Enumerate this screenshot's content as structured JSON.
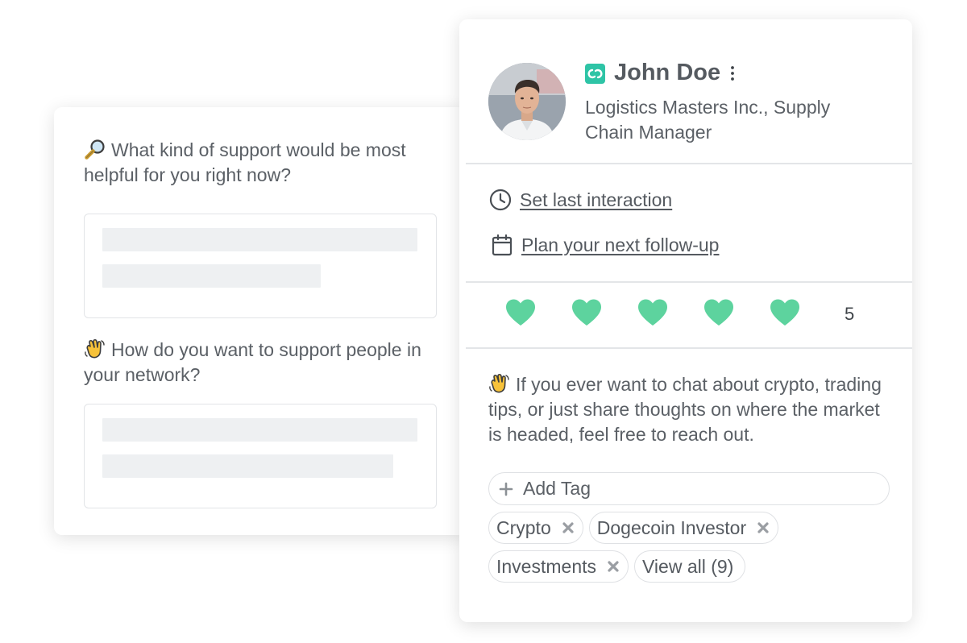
{
  "questions": [
    {
      "emoji": "magnifying-glass-icon",
      "text": "What kind of support would be most helpful for you right now?"
    },
    {
      "emoji": "waving-hand-icon",
      "text": "How do you want to support people in your network?"
    }
  ],
  "contact": {
    "name": "John Doe",
    "company": "Logistics Masters Inc., Supply Chain Manager",
    "actions": {
      "last_interaction": "Set last interaction",
      "follow_up": "Plan your next follow-up"
    },
    "rating": {
      "value": 5,
      "max": 5,
      "label": "5",
      "color": "#5dd39e"
    },
    "note": "If you ever want to chat about crypto, trading tips, or just share thoughts on where the market is headed, feel free to reach out.",
    "add_tag_placeholder": "Add Tag",
    "tags": [
      "Crypto",
      "Dogecoin Investor",
      "Investments"
    ],
    "view_all": "View all (9)"
  },
  "colors": {
    "accent": "#5dd39e",
    "brand": "#2ec4a6",
    "text": "#555a60",
    "border": "#e2e4e7"
  }
}
